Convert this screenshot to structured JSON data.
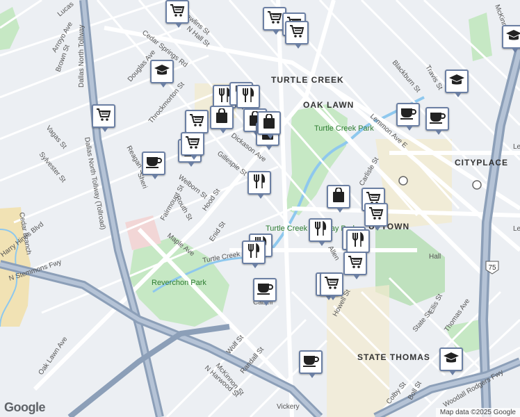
{
  "map": {
    "neighborhoods": [
      "TURTLE CREEK",
      "OAK LAWN",
      "CITYPLACE",
      "UPTOWN",
      "STATE THOMAS"
    ],
    "parks": [
      "Turtle Creek Park",
      "Turtle Creek Parkway Park",
      "Reverchon Park"
    ],
    "streets": [
      "Lucas",
      "Arroyo Ave",
      "Brown St",
      "Rawlins St",
      "N Hall St",
      "Cedar Springs Rd",
      "Douglas Ave",
      "Throckmorton St",
      "Dallas North Tollway",
      "Dallas North Tollway (Tollroad)",
      "Reagan St",
      "Vagas St",
      "Sylvester St",
      "Harry Hines Blvd",
      "Cedar Branch",
      "N Stemmons Fwy",
      "Oak Lawn Ave",
      "Maple Ave",
      "Welborn St",
      "Routh St",
      "Fairmount St",
      "Hood St",
      "Enid St",
      "Gillespie St",
      "Dickason Ave",
      "Turtle Creek Blvd",
      "Carlisle St",
      "Lemmon Ave E",
      "Blackburn St",
      "Travis St",
      "McKinney Ave",
      "Howell St",
      "Ellis St",
      "Thomas Ave",
      "State St",
      "Wolf St",
      "Randall St",
      "N Harwood St",
      "McKinnon St",
      "Colby St",
      "Boll St",
      "Woodall Rodgers Fwy",
      "Cabell",
      "Lemm",
      "Sheri",
      "Allen",
      "Vickery",
      "Hall",
      "Le"
    ],
    "highway_shield": "75",
    "attribution": "Map data ©2025 Google",
    "logo": "Google"
  },
  "markers": [
    {
      "icon": "cart"
    },
    {
      "icon": "cart"
    },
    {
      "icon": "cart"
    },
    {
      "icon": "cart"
    },
    {
      "icon": "school"
    },
    {
      "icon": "cart"
    },
    {
      "icon": "restaurant"
    },
    {
      "icon": "restaurant"
    },
    {
      "icon": "restaurant"
    },
    {
      "icon": "cart"
    },
    {
      "icon": "bag"
    },
    {
      "icon": "bag"
    },
    {
      "icon": "bag"
    },
    {
      "icon": "bag"
    },
    {
      "icon": "coffee"
    },
    {
      "icon": "bag"
    },
    {
      "icon": "restaurant"
    },
    {
      "icon": "cart"
    },
    {
      "icon": "restaurant"
    },
    {
      "icon": "restaurant"
    },
    {
      "icon": "restaurant"
    },
    {
      "icon": "bag"
    },
    {
      "icon": "cart"
    },
    {
      "icon": "cart"
    },
    {
      "icon": "school"
    },
    {
      "icon": "restaurant"
    },
    {
      "icon": "cart"
    },
    {
      "icon": "cart"
    },
    {
      "icon": "coffee"
    },
    {
      "icon": "coffee"
    },
    {
      "icon": "coffee"
    },
    {
      "icon": "school"
    },
    {
      "icon": "school"
    },
    {
      "icon": "cart"
    },
    {
      "icon": "coffee"
    },
    {
      "icon": "school"
    }
  ],
  "colors": {
    "water": "#8ec8ee",
    "park": "#c6e8c4",
    "freeway": "#8c9fb8",
    "pin_border": "#6b7fa3",
    "background": "#eceff3"
  }
}
